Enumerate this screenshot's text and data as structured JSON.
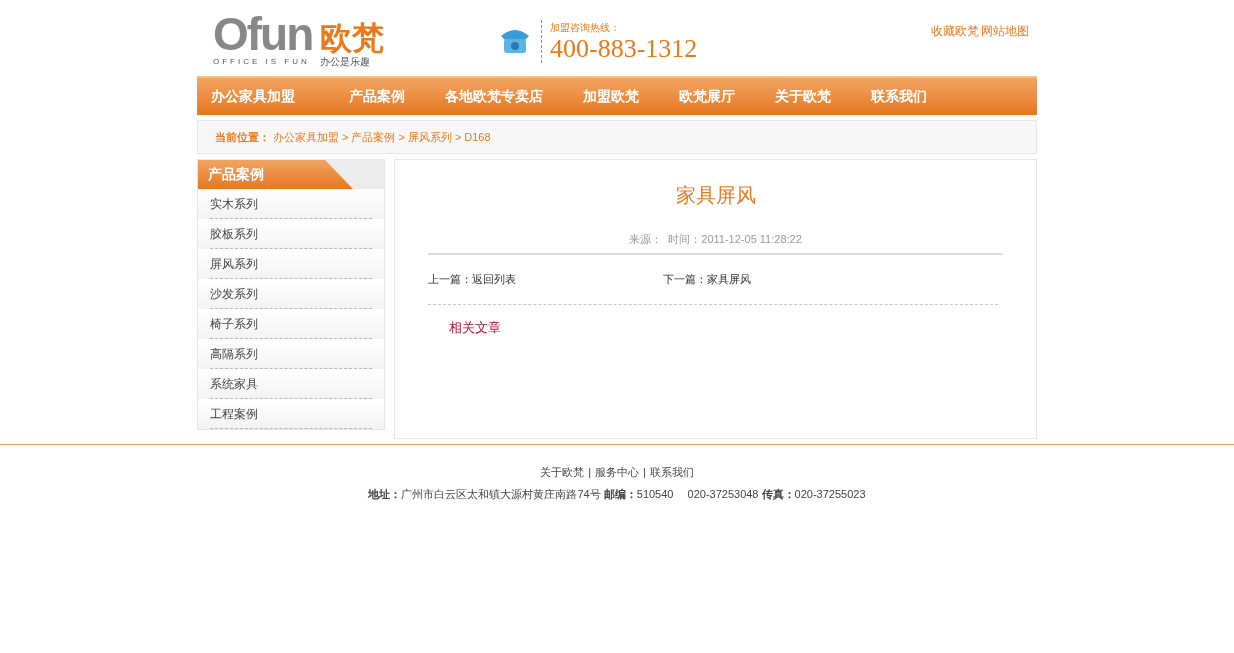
{
  "logo": {
    "wordmark": "Ofun",
    "name": "欧梵",
    "tagline": "OFFICE IS FUN",
    "slogan": "办公是乐趣"
  },
  "hotline": {
    "label": "加盟咨询热线：",
    "number": "400-883-1312"
  },
  "top_links": [
    "收藏欧梵",
    "网站地图"
  ],
  "nav": [
    "办公家具加盟",
    "产品案例",
    "各地欧梵专卖店",
    "加盟欧梵",
    "欧梵展厅",
    "关于欧梵",
    "联系我们"
  ],
  "breadcrumb": {
    "label": "当前位置：",
    "separator": ">",
    "items": [
      "办公家具加盟",
      "产品案例",
      "屏风系列",
      "D168"
    ]
  },
  "sidebar": {
    "title": "产品案例",
    "items": [
      "实木系列",
      "胶板系列",
      "屏风系列",
      "沙发系列",
      "椅子系列",
      "高隔系列",
      "系统家具",
      "工程案例"
    ]
  },
  "article": {
    "title": "家具屏风",
    "meta": "来源：  时间：2011-12-05 11:28:22",
    "prev": {
      "label": "上一篇：",
      "link": "返回列表"
    },
    "next": {
      "label": "下一篇：",
      "link": "家具屏风"
    },
    "related": "相关文章"
  },
  "footer": {
    "separator": "|",
    "links": [
      "关于欧梵",
      "服务中心",
      "联系我们"
    ],
    "address": "**地址：**广州市白云区太和镇大源村黄庄南路74号 **邮编：**510540　 020-37253048 **传真：**020-37255023"
  }
}
